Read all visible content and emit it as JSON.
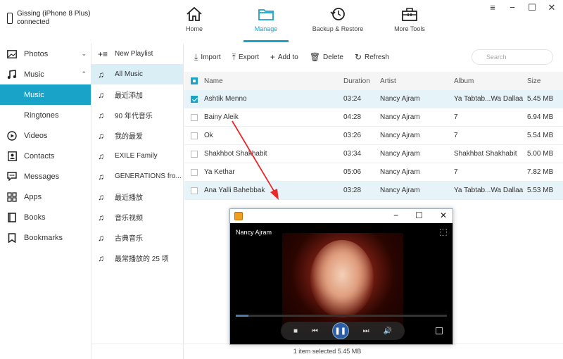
{
  "device": {
    "name_line1": "Gissing (iPhone 8 Plus)",
    "name_line2": "connected"
  },
  "nav": [
    {
      "label": "Home",
      "icon": "home-icon",
      "active": false
    },
    {
      "label": "Manage",
      "icon": "folder-icon",
      "active": true
    },
    {
      "label": "Backup & Restore",
      "icon": "backup-icon",
      "active": false
    },
    {
      "label": "More Tools",
      "icon": "toolbox-icon",
      "active": false
    }
  ],
  "sidebar": {
    "items": [
      {
        "label": "Photos",
        "icon": "photos-icon"
      },
      {
        "label": "Music",
        "icon": "music-icon"
      },
      {
        "label": "Music",
        "icon": ""
      },
      {
        "label": "Ringtones",
        "icon": ""
      },
      {
        "label": "Videos",
        "icon": "videos-icon"
      },
      {
        "label": "Contacts",
        "icon": "contacts-icon"
      },
      {
        "label": "Messages",
        "icon": "messages-icon"
      },
      {
        "label": "Apps",
        "icon": "apps-icon"
      },
      {
        "label": "Books",
        "icon": "books-icon"
      },
      {
        "label": "Bookmarks",
        "icon": "bookmarks-icon"
      }
    ]
  },
  "playlists": {
    "new_label": "New Playlist",
    "items": [
      "All Music",
      "最近添加",
      "90 年代音乐",
      "我的最爱",
      "EXILE Family",
      "GENERATIONS fro...",
      "最近播放",
      "音乐视频",
      "古典音乐",
      "最常播放的 25 项"
    ]
  },
  "toolbar": {
    "import": "Import",
    "export": "Export",
    "add": "Add to",
    "delete": "Delete",
    "refresh": "Refresh",
    "search_placeholder": "Search"
  },
  "table": {
    "headers": {
      "name": "Name",
      "duration": "Duration",
      "artist": "Artist",
      "album": "Album",
      "size": "Size"
    },
    "rows": [
      {
        "name": "Ashtik Menno",
        "duration": "03:24",
        "artist": "Nancy Ajram",
        "album": "Ya Tabtab...Wa Dallaa",
        "size": "5.45 MB",
        "checked": true
      },
      {
        "name": "Bainy Aleik",
        "duration": "04:28",
        "artist": "Nancy Ajram",
        "album": "7",
        "size": "6.94 MB",
        "checked": false
      },
      {
        "name": "Ok",
        "duration": "03:26",
        "artist": "Nancy Ajram",
        "album": "7",
        "size": "5.54 MB",
        "checked": false
      },
      {
        "name": "Shakhbot Shakhabit",
        "duration": "03:34",
        "artist": "Nancy Ajram",
        "album": "Shakhbat Shakhabit",
        "size": "5.00 MB",
        "checked": false
      },
      {
        "name": "Ya Kethar",
        "duration": "05:06",
        "artist": "Nancy Ajram",
        "album": "7",
        "size": "7.82 MB",
        "checked": false
      },
      {
        "name": "Ana Yalli Bahebbak",
        "duration": "03:28",
        "artist": "Nancy Ajram",
        "album": "Ya Tabtab...Wa Dallaa",
        "size": "5.53 MB",
        "checked": false
      }
    ]
  },
  "status": "1 item selected 5.45 MB",
  "player": {
    "artist": "Nancy Ajram",
    "progress": 0.06
  },
  "colors": {
    "accent": "#1aa3c9",
    "arrow": "#e8282a"
  }
}
